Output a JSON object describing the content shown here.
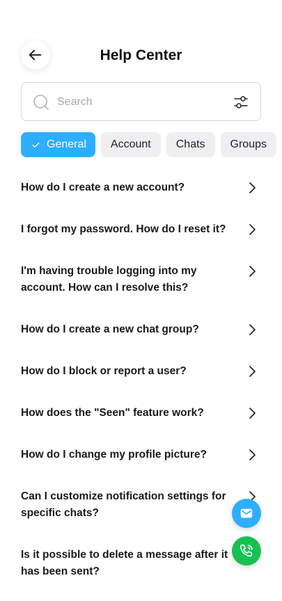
{
  "header": {
    "title": "Help Center",
    "back_icon": "arrow-left-icon"
  },
  "search": {
    "placeholder": "Search",
    "value": "",
    "search_icon": "search-icon",
    "filter_icon": "filter-sliders-icon"
  },
  "tabs": [
    {
      "label": "General",
      "active": true,
      "icon": "check-icon"
    },
    {
      "label": "Account",
      "active": false
    },
    {
      "label": "Chats",
      "active": false
    },
    {
      "label": "Groups",
      "active": false
    }
  ],
  "faq": [
    "How do I create a new account?",
    "I forgot my password. How do I reset it?",
    "I'm having trouble logging into my account. How can I resolve this?",
    "How do I create a new chat group?",
    "How do I block or report a user?",
    "How does the \"Seen\" feature work?",
    "How do I change my profile picture?",
    "Can I customize notification settings for specific chats?",
    "Is it possible to delete a message after it has been sent?"
  ],
  "fabs": {
    "mail_icon": "mail-icon",
    "call_icon": "phone-call-icon"
  },
  "colors": {
    "accent": "#2eaeff",
    "call": "#16c150",
    "tab_bg": "#efeff2"
  }
}
